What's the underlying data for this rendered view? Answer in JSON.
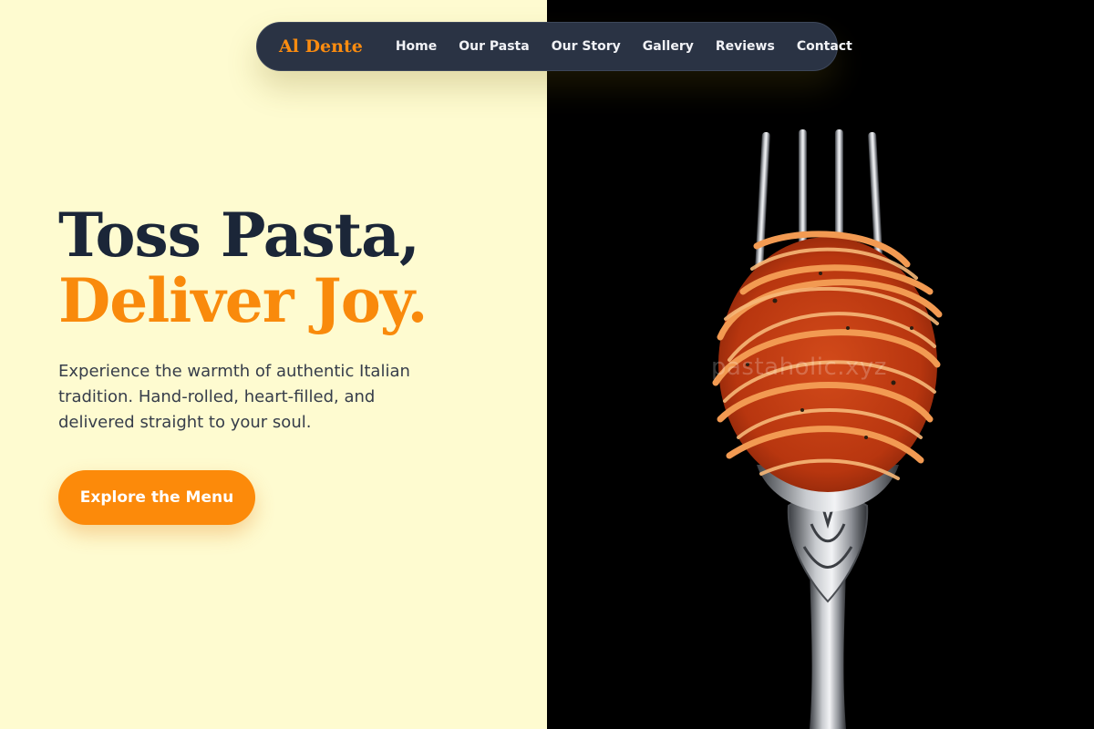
{
  "brand": {
    "name": "Al Dente",
    "color": "#fb8c10"
  },
  "nav": {
    "items": [
      {
        "label": "Home"
      },
      {
        "label": "Our Pasta"
      },
      {
        "label": "Our Story"
      },
      {
        "label": "Gallery"
      },
      {
        "label": "Reviews"
      },
      {
        "label": "Contact"
      }
    ]
  },
  "hero": {
    "headline_line1": "Toss Pasta,",
    "headline_line2": "Deliver Joy.",
    "subtitle": "Experience the warmth of authentic Italian tradition. Hand-rolled, heart-filled, and delivered straight to your soul.",
    "cta_label": "Explore the Menu"
  },
  "image": {
    "subject": "fork-with-spaghetti-in-tomato-sauce",
    "watermark": "pastaholic.xyz"
  },
  "colors": {
    "left_background": "#fefbd0",
    "right_background": "#000000",
    "navbar": "#2a3344",
    "headline_dark": "#1b2638",
    "accent_orange": "#f98a0c"
  }
}
